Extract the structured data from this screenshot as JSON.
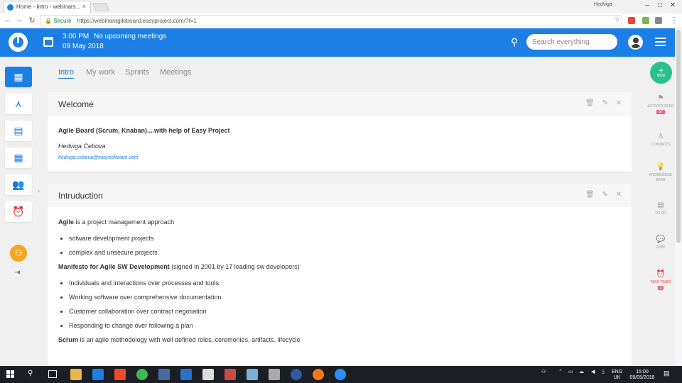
{
  "browser": {
    "tab_title": "Home - Intro - webinars...",
    "tab_close": "×",
    "profile": "Hedviga",
    "win_min": "–",
    "win_max": "□",
    "win_close": "✕",
    "secure_label": "Secure",
    "url": "https://webinaragileboard.easyproject.com/?t=1"
  },
  "appbar": {
    "time": "3:00 PM",
    "date": "09 May 2018",
    "meetings": "No upcoming meetings",
    "search_placeholder": "Search everything"
  },
  "main_tabs": [
    "Intro",
    "My work",
    "Sprints",
    "Meetings"
  ],
  "welcome": {
    "title": "Welcome",
    "heading": "Agile Board (Scrum, Knaban)....with help of Easy Project",
    "author": "Hedviga Cebova",
    "email": "hedviga.cebova@easysoftware.com"
  },
  "intro": {
    "title": "Intruduction",
    "agile_word": "Agile",
    "agile_text": " is a project management approach",
    "agile_bullets": [
      "sofware development projects",
      "complex and unsecure projects"
    ],
    "manifesto_word": "Manifesto for Agile SW Development",
    "manifesto_text": " (signed in 2001 by 17 leading sw developers)",
    "manifesto_bullets": [
      "Individuals and interactions over processes and tools",
      "Working software over comprehensive documentation",
      "Customer collaboration over contract negotiation",
      "Responding to change over following a plan"
    ],
    "scrum_word": "Scrum",
    "scrum_text": " is an agile methodology with well defined roles, ceremonies, artifacts, lifecycle"
  },
  "rightbar": {
    "new_label": "NEW",
    "activity_label": "ACTIVITY FEED",
    "activity_badge": "57",
    "contacts_label": "CONTACTS",
    "knowledge_label": "KNOWLEDGE BASE",
    "todo_label": "TO DO",
    "chat_label": "CHAT",
    "timer_label": "TASK TIMER",
    "timer_badge": "1"
  },
  "taskbar": {
    "lang": "ENG",
    "region": "UK",
    "clock_time": "15:00",
    "clock_date": "09/05/2018"
  },
  "colors": {
    "primary": "#1b7fe6",
    "new_button": "#2bbf8f",
    "warning": "#f5a623"
  }
}
